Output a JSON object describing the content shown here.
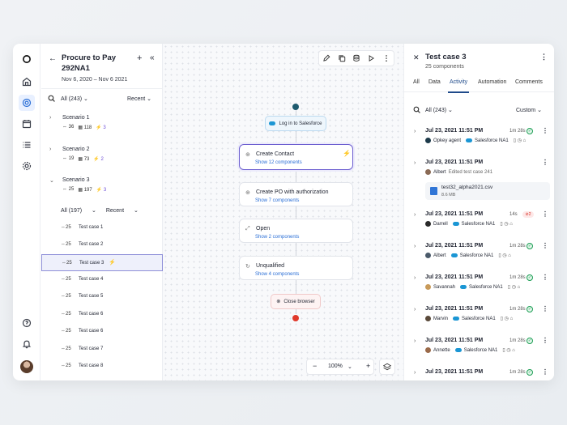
{
  "left": {
    "title": "Procure to Pay 292NA1",
    "dates": "Nov 6, 2020 – Nov 6 2021",
    "filter_all": "All (243)",
    "filter_sort": "Recent",
    "scenarios": [
      {
        "name": "Scenario 1",
        "a": "36",
        "b": "118",
        "c": "3"
      },
      {
        "name": "Scenario 2",
        "a": "19",
        "b": "73",
        "c": "2"
      },
      {
        "name": "Scenario 3",
        "a": "25",
        "b": "197",
        "c": "3"
      }
    ],
    "tc_filter_all": "All (197)",
    "tc_filter_sort": "Recent",
    "test_cases": [
      {
        "count": "25",
        "name": "Test case 1"
      },
      {
        "count": "25",
        "name": "Test case 2"
      },
      {
        "count": "25",
        "name": "Test case 3"
      },
      {
        "count": "25",
        "name": "Test case 4"
      },
      {
        "count": "25",
        "name": "Test case 5"
      },
      {
        "count": "25",
        "name": "Test case 6"
      },
      {
        "count": "25",
        "name": "Test case 6"
      },
      {
        "count": "25",
        "name": "Test case 7"
      },
      {
        "count": "25",
        "name": "Test case 8"
      }
    ]
  },
  "canvas": {
    "start_pill": "Log in to Salesforce",
    "nodes": [
      {
        "title": "Create Contact",
        "sub": "Show 12 components"
      },
      {
        "title": "Create PO with authorization",
        "sub": "Show 7 components"
      },
      {
        "title": "Open",
        "sub": "Show 2 components"
      },
      {
        "title": "Unqualified",
        "sub": "Show 4 components"
      }
    ],
    "end_pill": "Close browser",
    "zoom": "100%"
  },
  "right": {
    "title": "Test case 3",
    "subtitle": "25 components",
    "tabs": [
      "All",
      "Data",
      "Activity",
      "Automation",
      "Comments"
    ],
    "filter_all": "All (243)",
    "filter_sort": "Custom",
    "activity": [
      {
        "date": "Jul 23, 2021 11:51 PM",
        "dur": "1m 28s",
        "status": "ok",
        "user": "Opkey agent",
        "app": "Salesforce NA1"
      },
      {
        "date": "Jul 23, 2021 11:51 PM",
        "dur": "",
        "status": "",
        "user": "Albert",
        "note": "Edited test case 241",
        "file": "test32_alpha2021.csv",
        "size": "8.6 MB"
      },
      {
        "date": "Jul 23, 2021 11:51 PM",
        "dur": "14s",
        "status": "err",
        "errcount": "2",
        "user": "Darrell",
        "app": "Salesforce NA1"
      },
      {
        "date": "Jul 23, 2021 11:51 PM",
        "dur": "1m 28s",
        "status": "ok",
        "user": "Albert",
        "app": "Salesforce NA1"
      },
      {
        "date": "Jul 23, 2021 11:51 PM",
        "dur": "1m 28s",
        "status": "ok",
        "user": "Savannah",
        "app": "Salesforce NA1"
      },
      {
        "date": "Jul 23, 2021 11:51 PM",
        "dur": "1m 28s",
        "status": "ok",
        "user": "Marvin",
        "app": "Salesforce NA1"
      },
      {
        "date": "Jul 23, 2021 11:51 PM",
        "dur": "1m 28s",
        "status": "ok",
        "user": "Annette",
        "app": "Salesforce NA1"
      },
      {
        "date": "Jul 23, 2021 11:51 PM",
        "dur": "1m 28s",
        "status": "ok"
      }
    ]
  }
}
